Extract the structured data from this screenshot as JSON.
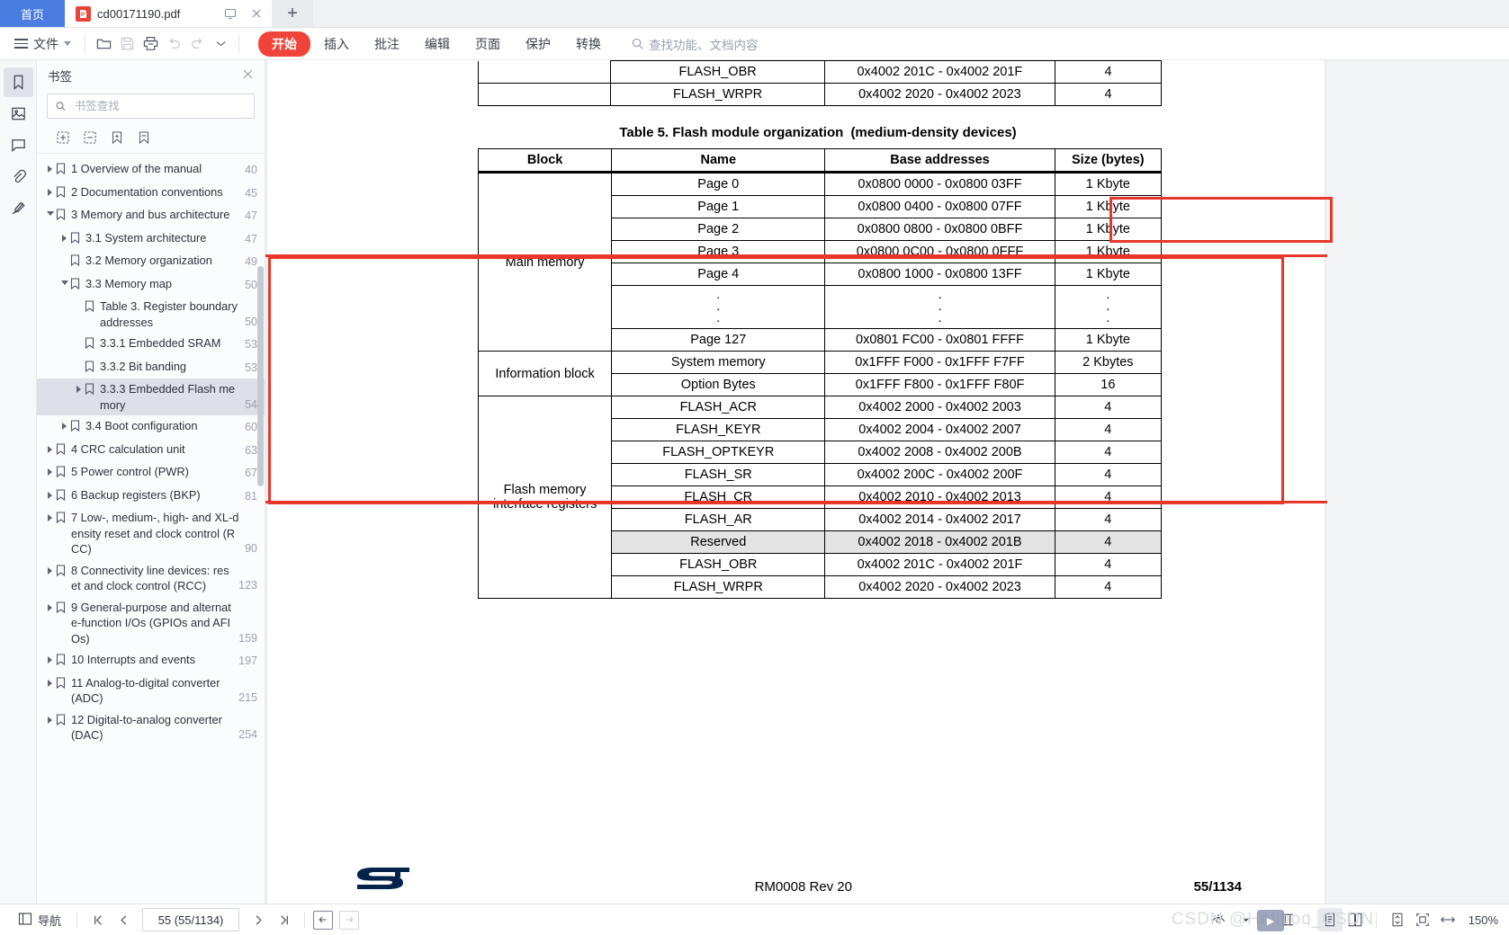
{
  "tabbar": {
    "home_label": "首页",
    "doc_tab_label": "cd00171190.pdf",
    "pdf_badge": "P",
    "cast_icon": "cast-icon",
    "close_icon": "×",
    "new_tab": "+"
  },
  "toolbar": {
    "file_label": "文件",
    "ribbon_tabs": [
      {
        "label": "开始",
        "active": true
      },
      {
        "label": "插入",
        "active": false
      },
      {
        "label": "批注",
        "active": false
      },
      {
        "label": "编辑",
        "active": false
      },
      {
        "label": "页面",
        "active": false
      },
      {
        "label": "保护",
        "active": false
      },
      {
        "label": "转换",
        "active": false
      }
    ],
    "search_placeholder": "查找功能、文档内容",
    "icons": [
      "open-folder-icon",
      "save-icon",
      "print-icon",
      "undo-icon",
      "redo-icon",
      "customize-caret-icon"
    ]
  },
  "rail": {
    "items": [
      {
        "name": "bookmark-icon",
        "active": true
      },
      {
        "name": "thumbnail-icon",
        "active": false
      },
      {
        "name": "comment-icon",
        "active": false
      },
      {
        "name": "attachment-icon",
        "active": false
      },
      {
        "name": "signature-icon",
        "active": false
      }
    ]
  },
  "bookmarks_panel": {
    "title": "书签",
    "close_label": "×",
    "search_placeholder": "书签查找",
    "tools": [
      "expand-all-icon",
      "collapse-all-icon",
      "add-bookmark-icon",
      "bookmark-options-icon"
    ],
    "items": [
      {
        "label": "1 Overview of the manual",
        "page": "40",
        "indent": 0,
        "arrow": "closed",
        "selected": false
      },
      {
        "label": "2 Documentation conventions",
        "page": "45",
        "indent": 0,
        "arrow": "closed",
        "selected": false
      },
      {
        "label": "3 Memory and bus architecture",
        "page": "47",
        "indent": 0,
        "arrow": "open",
        "selected": false
      },
      {
        "label": "3.1 System architecture",
        "page": "47",
        "indent": 1,
        "arrow": "closed",
        "selected": false
      },
      {
        "label": "3.2 Memory organization",
        "page": "49",
        "indent": 1,
        "arrow": "none",
        "selected": false
      },
      {
        "label": "3.3 Memory map",
        "page": "50",
        "indent": 1,
        "arrow": "open",
        "selected": false
      },
      {
        "label": "Table 3. Register boundary addresses",
        "page": "50",
        "indent": 2,
        "arrow": "none",
        "selected": false
      },
      {
        "label": "3.3.1 Embedded SRAM",
        "page": "53",
        "indent": 2,
        "arrow": "none",
        "selected": false
      },
      {
        "label": "3.3.2 Bit banding",
        "page": "53",
        "indent": 2,
        "arrow": "none",
        "selected": false
      },
      {
        "label": "3.3.3 Embedded Flash memory",
        "page": "54",
        "indent": 2,
        "arrow": "closed",
        "selected": true
      },
      {
        "label": "3.4 Boot configuration",
        "page": "60",
        "indent": 1,
        "arrow": "closed",
        "selected": false
      },
      {
        "label": "4 CRC calculation unit",
        "page": "63",
        "indent": 0,
        "arrow": "closed",
        "selected": false
      },
      {
        "label": "5 Power control (PWR)",
        "page": "67",
        "indent": 0,
        "arrow": "closed",
        "selected": false
      },
      {
        "label": "6 Backup registers (BKP)",
        "page": "81",
        "indent": 0,
        "arrow": "closed",
        "selected": false
      },
      {
        "label": "7 Low-, medium-, high- and XL-density reset and clock control (RCC)",
        "page": "90",
        "indent": 0,
        "arrow": "closed",
        "selected": false
      },
      {
        "label": "8 Connectivity line devices: reset and clock control (RCC)",
        "page": "123",
        "indent": 0,
        "arrow": "closed",
        "selected": false
      },
      {
        "label": "9 General-purpose and alternate-function I/Os (GPIOs and AFIOs)",
        "page": "159",
        "indent": 0,
        "arrow": "closed",
        "selected": false
      },
      {
        "label": "10 Interrupts and events",
        "page": "197",
        "indent": 0,
        "arrow": "closed",
        "selected": false
      },
      {
        "label": "11 Analog-to-digital converter (ADC)",
        "page": "215",
        "indent": 0,
        "arrow": "closed",
        "selected": false
      },
      {
        "label": "12 Digital-to-analog converter (DAC)",
        "page": "254",
        "indent": 0,
        "arrow": "closed",
        "selected": false
      }
    ]
  },
  "document": {
    "top_table_rows": [
      {
        "name": "FLASH_OBR",
        "addr": "0x4002 201C - 0x4002 201F",
        "size": "4"
      },
      {
        "name": "FLASH_WRPR",
        "addr": "0x4002 2020 - 0x4002 2023",
        "size": "4"
      }
    ],
    "table5": {
      "caption_main": "Table 5. Flash module organization ",
      "caption_highlight": "(medium-density devices)",
      "headers": [
        "Block",
        "Name",
        "Base addresses",
        "Size (bytes)"
      ],
      "blocks": [
        {
          "block": "Main memory",
          "rows": [
            {
              "name": "Page 0",
              "addr": "0x0800 0000 - 0x0800 03FF",
              "size": "1 Kbyte"
            },
            {
              "name": "Page 1",
              "addr": "0x0800 0400 - 0x0800 07FF",
              "size": "1 Kbyte"
            },
            {
              "name": "Page 2",
              "addr": "0x0800 0800 - 0x0800 0BFF",
              "size": "1 Kbyte"
            },
            {
              "name": "Page 3",
              "addr": "0x0800 0C00 - 0x0800 0FFF",
              "size": "1 Kbyte"
            },
            {
              "name": "Page 4",
              "addr": "0x0800 1000 - 0x0800 13FF",
              "size": "1 Kbyte"
            },
            {
              "name": ".\n.\n.",
              "addr": ".\n.\n.",
              "size": ".\n.\n.",
              "is_dots": true
            },
            {
              "name": "Page 127",
              "addr": "0x0801 FC00 - 0x0801 FFFF",
              "size": "1 Kbyte"
            }
          ]
        },
        {
          "block": "Information block",
          "rows": [
            {
              "name": "System memory",
              "addr": "0x1FFF F000 - 0x1FFF F7FF",
              "size": "2 Kbytes"
            },
            {
              "name": "Option Bytes",
              "addr": "0x1FFF F800 - 0x1FFF F80F",
              "size": "16"
            }
          ]
        },
        {
          "block": "Flash memory interface registers",
          "rows": [
            {
              "name": "FLASH_ACR",
              "addr": "0x4002 2000 - 0x4002 2003",
              "size": "4"
            },
            {
              "name": "FLASH_KEYR",
              "addr": "0x4002 2004 - 0x4002 2007",
              "size": "4"
            },
            {
              "name": "FLASH_OPTKEYR",
              "addr": "0x4002 2008 - 0x4002 200B",
              "size": "4"
            },
            {
              "name": "FLASH_SR",
              "addr": "0x4002 200C - 0x4002 200F",
              "size": "4"
            },
            {
              "name": "FLASH_CR",
              "addr": "0x4002 2010 - 0x4002 2013",
              "size": "4"
            },
            {
              "name": "FLASH_AR",
              "addr": "0x4002 2014 - 0x4002 2017",
              "size": "4"
            },
            {
              "name": "Reserved",
              "addr": "0x4002 2018 - 0x4002 201B",
              "size": "4",
              "shaded": true
            },
            {
              "name": "FLASH_OBR",
              "addr": "0x4002 201C - 0x4002 201F",
              "size": "4"
            },
            {
              "name": "FLASH_WRPR",
              "addr": "0x4002 2020 - 0x4002 2023",
              "size": "4"
            }
          ]
        }
      ]
    },
    "footer": {
      "logo": "st-logo",
      "revision": "RM0008 Rev 20",
      "pageno": "55/1134"
    }
  },
  "statusbar": {
    "nav_label": "导航",
    "first_page_icon": "first-page-icon",
    "prev_page_icon": "prev-page-icon",
    "page_value": "55 (55/1134)",
    "next_page_icon": "next-page-icon",
    "last_page_icon": "last-page-icon",
    "back_icon": "←",
    "forward_icon": "→",
    "view_mode_icon": "eye-icon",
    "fit_icon": "fit-height-icon",
    "single_page_icon": "single-page-icon",
    "double_page_icon": "double-page-icon",
    "fit_page_icon": "fit-page-icon",
    "fit_width_icon": "fit-width-icon",
    "actual_size_icon": "actual-size-icon",
    "zoom_level": "150%"
  },
  "watermark": {
    "text": "CSDN @Hellooo_CSDN"
  },
  "colors": {
    "accent_red": "#f0443a",
    "tab_blue": "#4a7ce2",
    "annotation_red": "#e8372a",
    "pdf_badge_red": "#e8443a",
    "st_blue": "#03234b"
  }
}
